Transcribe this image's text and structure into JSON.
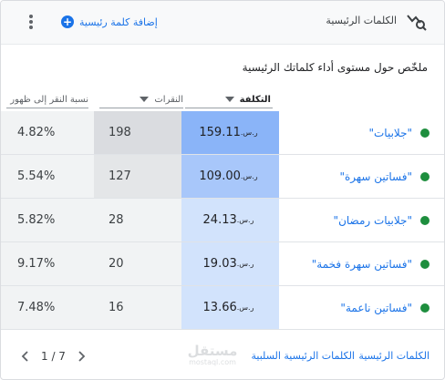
{
  "header": {
    "title": "الكلمات الرئيسية",
    "add_label": "إضافة كلمة رئيسية",
    "add_icon": "plus-circle-icon",
    "menu_icon": "more-vert-icon",
    "title_icon": "keyword-search-icon"
  },
  "summary_title": "ملخّص حول مستوى أداء كلماتك الرئيسية",
  "columns": {
    "cost": "التكلفة",
    "clicks": "النقرات",
    "ctr": "نسبة النقر إلى ظهور"
  },
  "rows": [
    {
      "keyword": "\"جلابيات\"",
      "cost": "159.11",
      "currency": "ر.س.",
      "clicks": "198",
      "ctr": "4.82%"
    },
    {
      "keyword": "\"فساتين سهرة\"",
      "cost": "109.00",
      "currency": "ر.س.",
      "clicks": "127",
      "ctr": "5.54%"
    },
    {
      "keyword": "\"جلابيات رمضان\"",
      "cost": "24.13",
      "currency": "ر.س.",
      "clicks": "28",
      "ctr": "5.82%"
    },
    {
      "keyword": "\"فساتين سهرة فخمة\"",
      "cost": "19.03",
      "currency": "ر.س.",
      "clicks": "20",
      "ctr": "9.17%"
    },
    {
      "keyword": "\"فساتين ناعمة\"",
      "cost": "13.66",
      "currency": "ر.س.",
      "clicks": "16",
      "ctr": "7.48%"
    }
  ],
  "footer": {
    "keywords_link": "الكلمات الرئيسية",
    "negative_link": "الكلمات الرئيسية السلبية",
    "pagination": "1 / 7",
    "watermark_main": "مستقل",
    "watermark_sub": "mostaql.com"
  },
  "colors": {
    "accent": "#1a73e8",
    "status_green": "#1e8e3e",
    "cost_heat_high": "#8ab4f8",
    "cost_heat_mid": "#a8c7fa",
    "cost_heat_low": "#d2e3fc",
    "clicks_heat_high": "#dadce0",
    "clicks_heat_low": "#f1f3f4"
  }
}
